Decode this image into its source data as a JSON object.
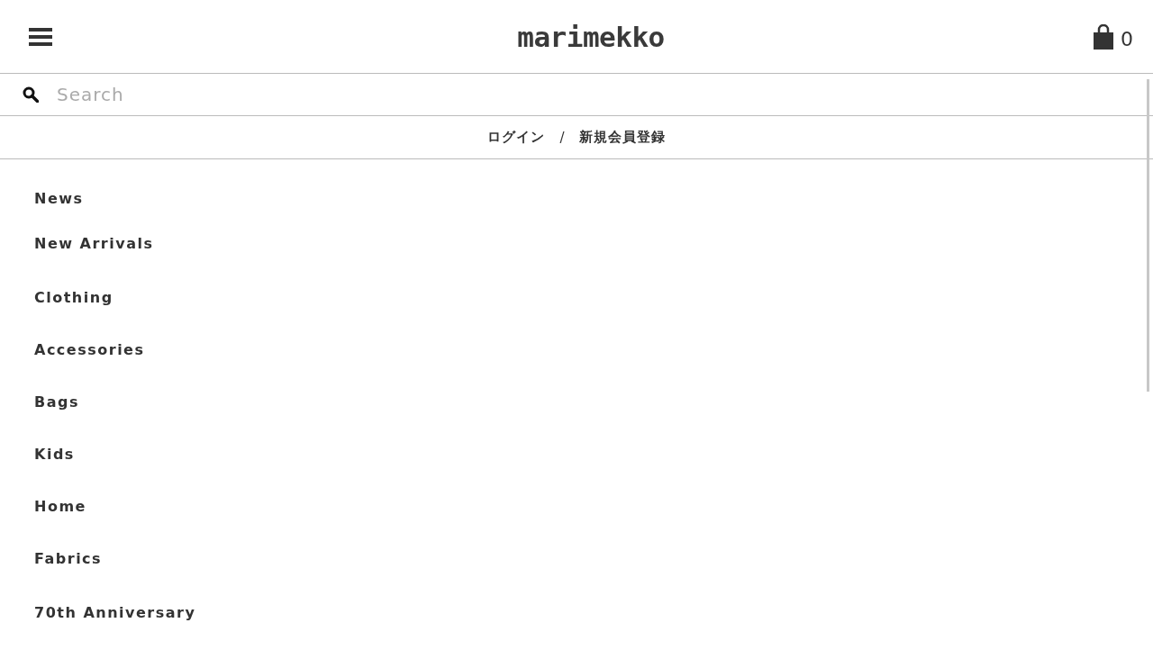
{
  "header": {
    "logo": "marimekko",
    "cart_count": "0"
  },
  "search": {
    "placeholder": "Search"
  },
  "account": {
    "login": "ログイン",
    "separator": "/",
    "register": "新規会員登録"
  },
  "menu_groups": [
    {
      "items": [
        "News",
        "New Arrivals"
      ]
    },
    {
      "items": [
        "Clothing",
        "Accessories",
        "Bags",
        "Kids",
        "Home",
        "Fabrics"
      ]
    },
    {
      "items": [
        "70th Anniversary"
      ]
    }
  ]
}
